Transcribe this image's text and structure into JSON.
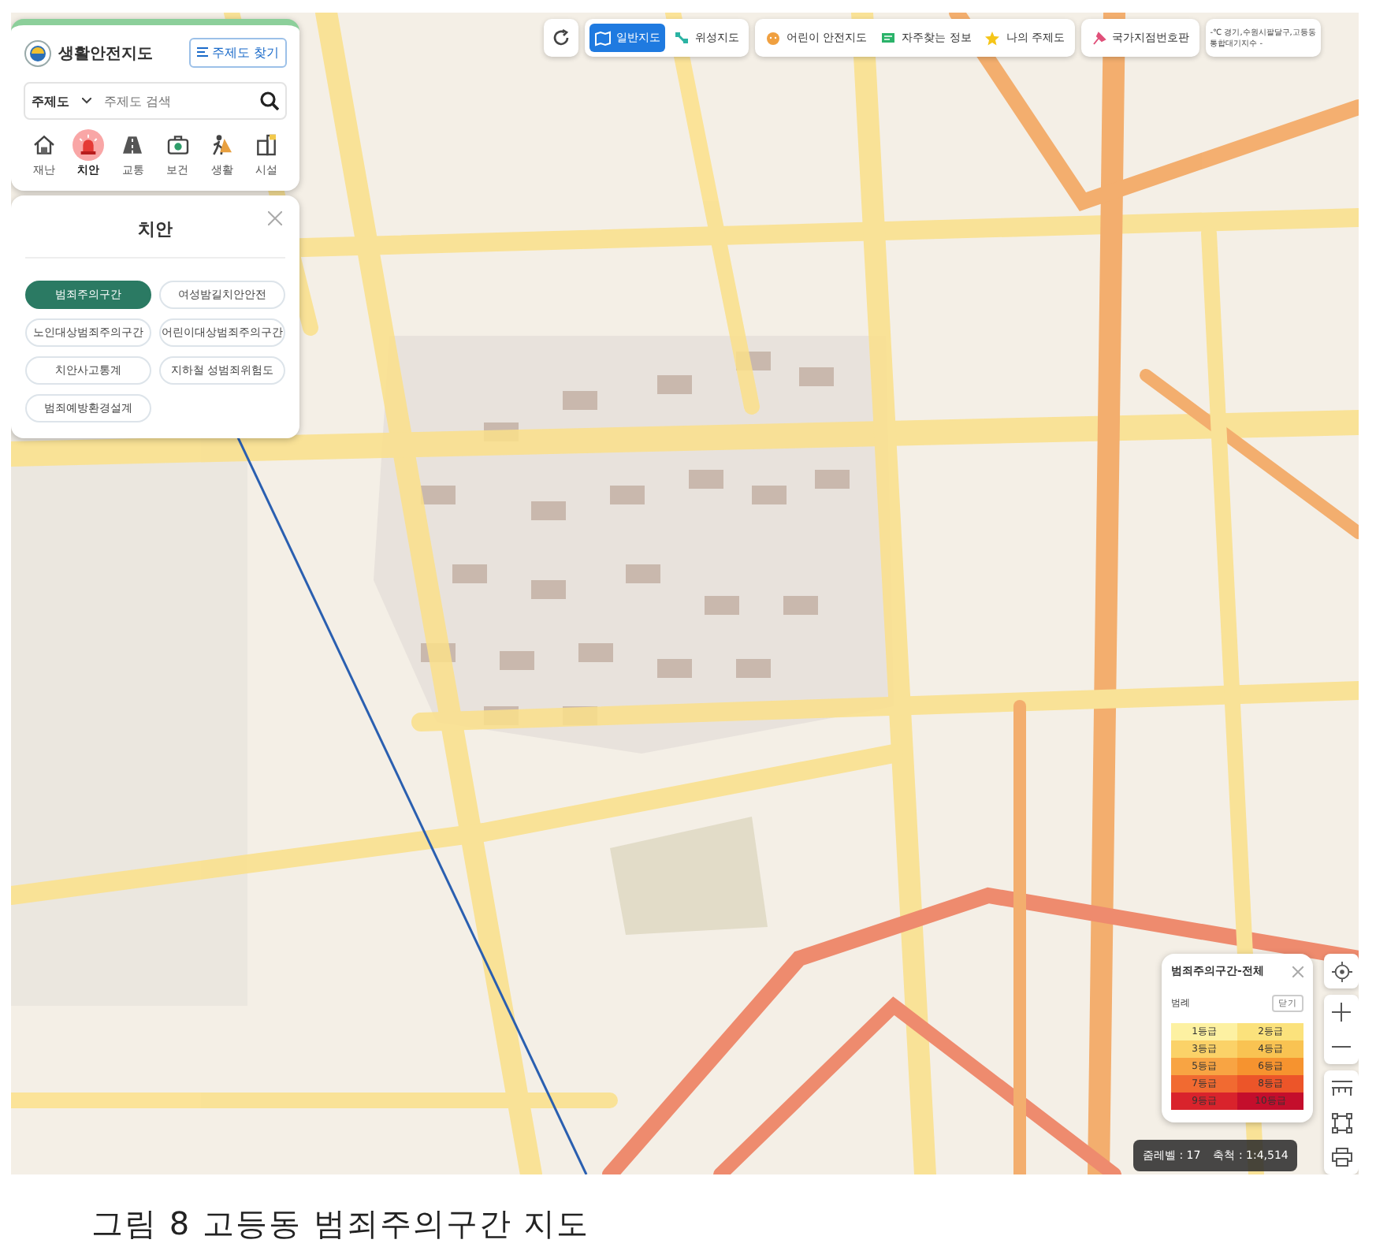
{
  "app": {
    "logo_text": "생활안전지도",
    "find_button": "주제도 찾기"
  },
  "search": {
    "select": "주제도",
    "placeholder": "주제도 검색"
  },
  "categories": [
    {
      "label": "재난",
      "kind": "house",
      "selected": false
    },
    {
      "label": "치안",
      "kind": "siren",
      "selected": true
    },
    {
      "label": "교통",
      "kind": "road",
      "selected": false
    },
    {
      "label": "보건",
      "kind": "medkit",
      "selected": false
    },
    {
      "label": "생활",
      "kind": "person",
      "selected": false
    },
    {
      "label": "시설",
      "kind": "building",
      "selected": false
    }
  ],
  "panel": {
    "title": "치안",
    "options": [
      {
        "label": "범죄주의구간",
        "selected": true
      },
      {
        "label": "여성밤길치안안전",
        "selected": false
      },
      {
        "label": "노인대상범죄주의구간",
        "selected": false
      },
      {
        "label": "어린이대상범죄주의구간",
        "selected": false
      },
      {
        "label": "치안사고통계",
        "selected": false
      },
      {
        "label": "지하철 성범죄위험도",
        "selected": false
      },
      {
        "label": "범죄예방환경설계",
        "selected": false
      }
    ]
  },
  "map_types": [
    {
      "label": "일반지도",
      "kind": "map",
      "selected": true
    },
    {
      "label": "위성지도",
      "kind": "satellite",
      "selected": false
    }
  ],
  "tools": [
    {
      "label": "어린이 안전지도",
      "kind": "child"
    },
    {
      "label": "자주찾는 정보",
      "kind": "chat"
    },
    {
      "label": "나의 주제도",
      "kind": "star"
    }
  ],
  "national_point": "국가지점번호판",
  "weather": {
    "location": "-℃ 경기,수원시팔달구,고등동",
    "air": "통합대기지수 -"
  },
  "legend": {
    "title": "범죄주의구간-전체",
    "subtitle": "범례",
    "close_button": "닫기",
    "grades": [
      {
        "label": "1등급",
        "color": "#fdf1a2"
      },
      {
        "label": "2등급",
        "color": "#fbe27c"
      },
      {
        "label": "3등급",
        "color": "#fbd268"
      },
      {
        "label": "4등급",
        "color": "#f9c352"
      },
      {
        "label": "5등급",
        "color": "#f8a443"
      },
      {
        "label": "6등급",
        "color": "#f6932f"
      },
      {
        "label": "7등급",
        "color": "#f16a31"
      },
      {
        "label": "8등급",
        "color": "#ec5529"
      },
      {
        "label": "9등급",
        "color": "#d9232c"
      },
      {
        "label": "10등급",
        "color": "#c40e2c"
      }
    ]
  },
  "status": {
    "zoom": "줌레벨 : 17",
    "scale": "축척 : 1:4,514"
  },
  "caption": "그림 8 고등동 범죄주의구간 지도"
}
